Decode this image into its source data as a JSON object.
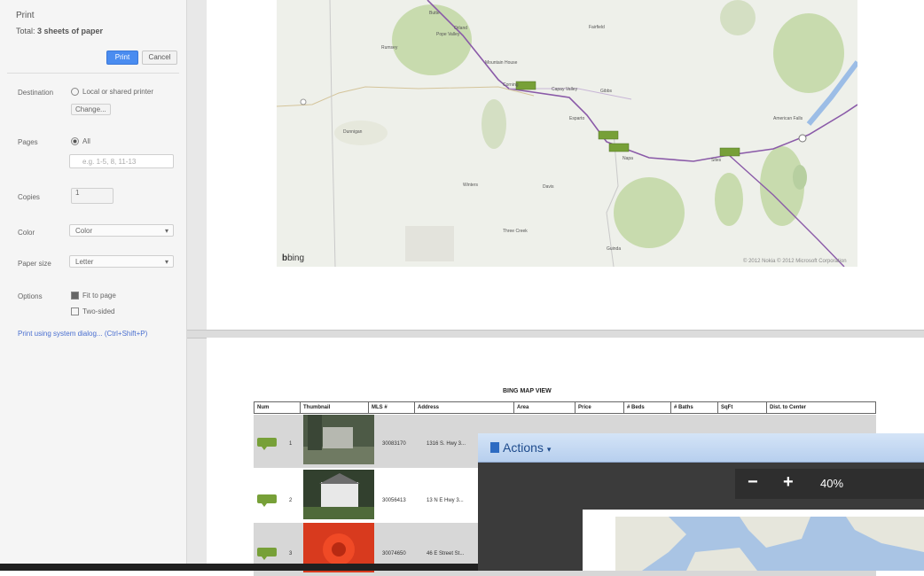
{
  "sidebar": {
    "title": "Print",
    "total_prefix": "Total:",
    "total_value": "3 sheets of paper",
    "print_button": "Print",
    "cancel_button": "Cancel",
    "destination_label": "Destination",
    "destination_value": "Local or shared printer",
    "change_button": "Change...",
    "pages_label": "Pages",
    "pages_all": "All",
    "pages_placeholder": "e.g. 1-5, 8, 11-13",
    "copies_label": "Copies",
    "copies_value": "1",
    "color_label": "Color",
    "color_value": "Color",
    "paper_label": "Paper size",
    "paper_value": "Letter",
    "options_label": "Options",
    "option_fit": "Fit to page",
    "option_two_sided": "Two-sided",
    "dialog_link": "Print using system dialog... (Ctrl+Shift+P)"
  },
  "map": {
    "places": [
      "Butte",
      "Orland",
      "Mountain House",
      "Corning",
      "Fairfield",
      "Rumsey",
      "Gibbs",
      "Capay Valley",
      "Esparto",
      "Winters",
      "Davis",
      "Dunnigan",
      "Pope Valley",
      "Three Creek",
      "Napa",
      "American Falls",
      "Guinda",
      "Sites"
    ],
    "logo": "bing",
    "copyright": "© 2012 Nokia © 2012 Microsoft Corporation"
  },
  "listing": {
    "title": "BING MAP VIEW",
    "columns": [
      "Num",
      "Thumbnail",
      "MLS #",
      "Address",
      "Area",
      "Price",
      "# Beds",
      "# Baths",
      "SqFt",
      "Dist. to Center"
    ],
    "rows": [
      {
        "num": "1",
        "mls": "30083170",
        "address": "1316 S. Hwy 3..."
      },
      {
        "num": "2",
        "mls": "30056413",
        "address": "13 N E Hwy 3..."
      },
      {
        "num": "3",
        "mls": "30074650",
        "address": "46 E Street St..."
      }
    ]
  },
  "viewer": {
    "actions_label": "Actions",
    "zoom_out": "−",
    "zoom_in": "+",
    "zoom_level": "40%"
  },
  "colors": {
    "print_button": "#4a8cf0",
    "map_pin": "#77a038",
    "route": "#8a5aa8",
    "viewer_bar": "#c8dbf3"
  }
}
